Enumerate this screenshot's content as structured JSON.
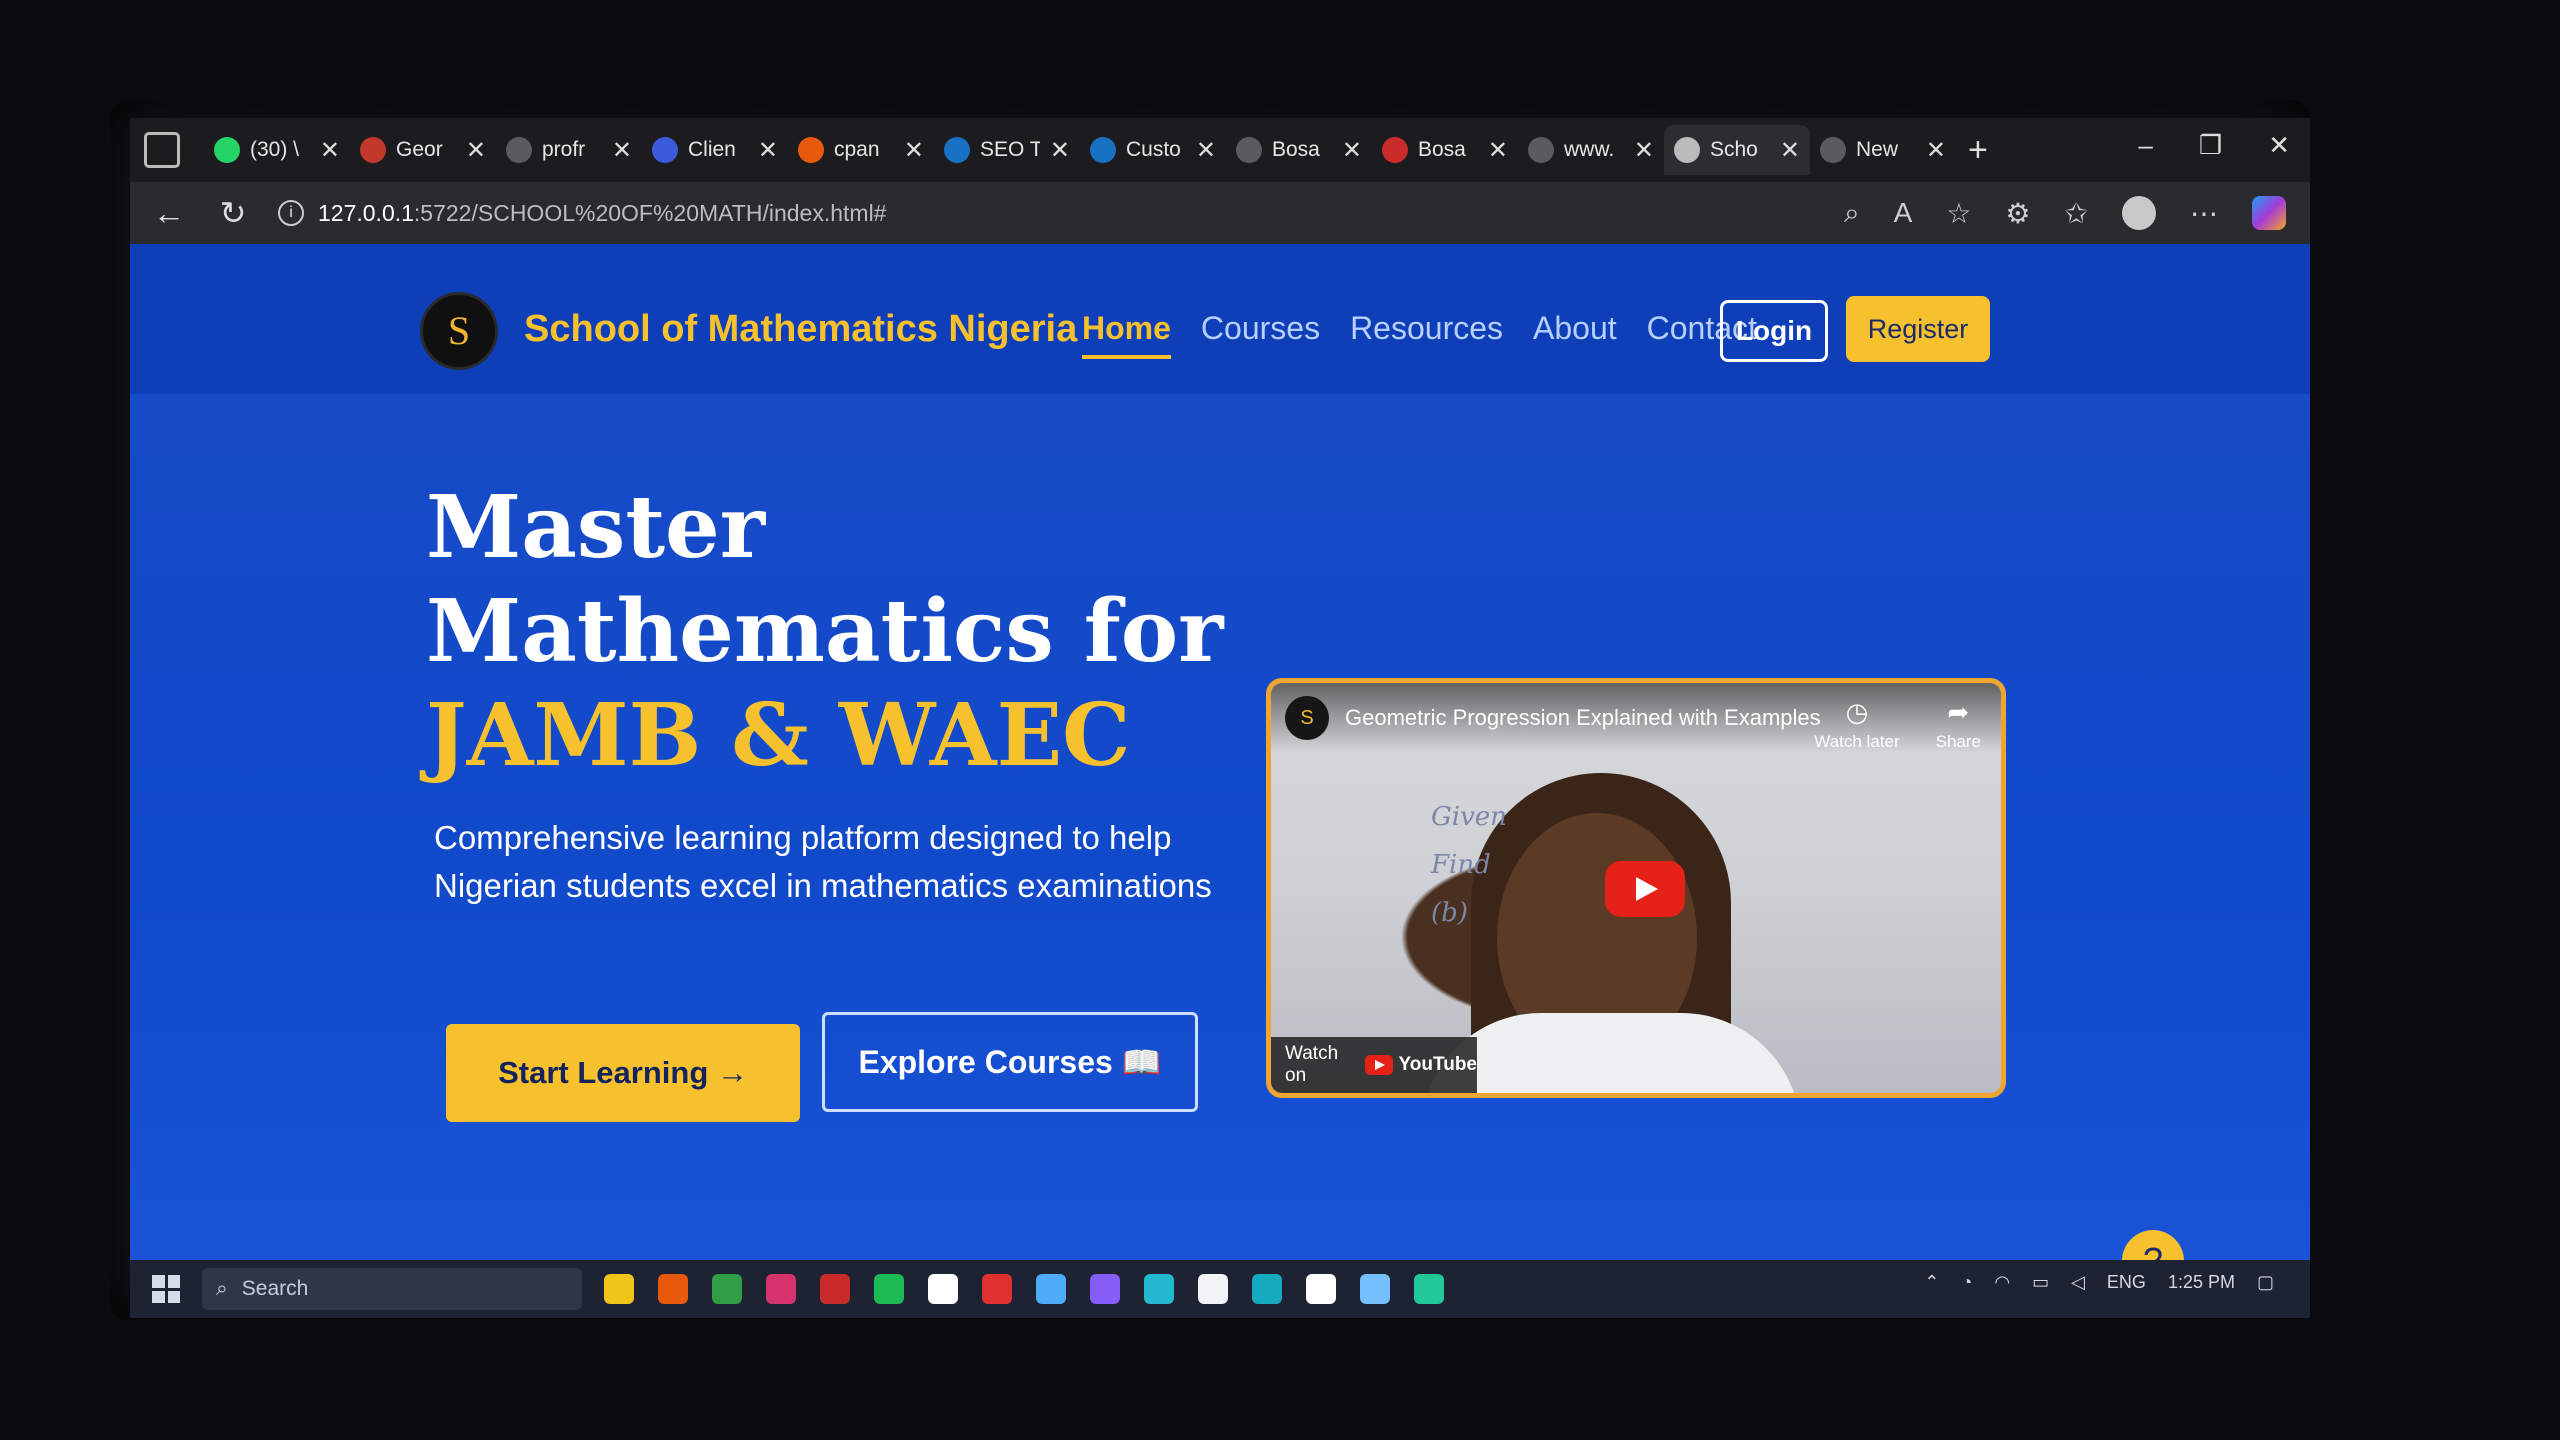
{
  "browser": {
    "tabs": [
      {
        "title": "(30) \\",
        "color": "#25d366",
        "active": false
      },
      {
        "title": "Geor",
        "color": "#c0392b",
        "active": false
      },
      {
        "title": "profr",
        "color": "#5a5a60",
        "active": false
      },
      {
        "title": "Clien",
        "color": "#3b5bdb",
        "active": false
      },
      {
        "title": "cpan",
        "color": "#e8590c",
        "active": false
      },
      {
        "title": "SEO T",
        "color": "#1971c2",
        "active": false
      },
      {
        "title": "Custo",
        "color": "#1971c2",
        "active": false
      },
      {
        "title": "Bosa",
        "color": "#5a5a60",
        "active": false
      },
      {
        "title": "Bosa",
        "color": "#c92a2a",
        "active": false
      },
      {
        "title": "www.",
        "color": "#5a5a60",
        "active": false
      },
      {
        "title": "Scho",
        "color": "#bbbbbb",
        "active": true
      },
      {
        "title": "New",
        "color": "#5a5a60",
        "active": false
      }
    ],
    "close_glyph": "✕",
    "new_tab_glyph": "+",
    "url_host": "127.0.0.1",
    "url_path": ":5722/SCHOOL%20OF%20MATH/index.html#"
  },
  "site": {
    "logo_letter": "S",
    "brand": "School of Mathematics Nigeria",
    "nav": {
      "home": "Home",
      "courses": "Courses",
      "resources": "Resources",
      "about": "About",
      "contact": "Contact"
    },
    "login": "Login",
    "register": "Register",
    "hero": {
      "line1": "Master",
      "line2": "Mathematics for",
      "line3": "JAMB & WAEC",
      "subtitle": "Comprehensive learning platform designed to help Nigerian students excel in mathematics examinations",
      "start_button": "Start Learning →",
      "explore_button": "Explore Courses 📖"
    },
    "video": {
      "channel_letter": "S",
      "title": "Geometric Progression Explained with Examples",
      "watch_later": "Watch later",
      "share": "Share",
      "watch_on": "Watch on",
      "youtube": "YouTube",
      "board_lines": [
        "Given",
        "Find",
        "(b)"
      ]
    },
    "help_glyph": "?"
  },
  "taskbar": {
    "search_placeholder": "Search",
    "language": "ENG",
    "time": "1:25 PM",
    "apps": [
      "#f0c419",
      "#e8590c",
      "#2f9e44",
      "#d6336c",
      "#c92a2a",
      "#1db954",
      "#ffffff",
      "#e03131",
      "#4dabf7",
      "#845ef7",
      "#22b8cf",
      "#f1f3f5",
      "#15aabf",
      "#ffffff",
      "#74c0fc",
      "#20c997"
    ]
  },
  "colors": {
    "accent_yellow": "#f7c12e",
    "hero_blue": "#1049c9",
    "video_border": "#f0a530"
  }
}
